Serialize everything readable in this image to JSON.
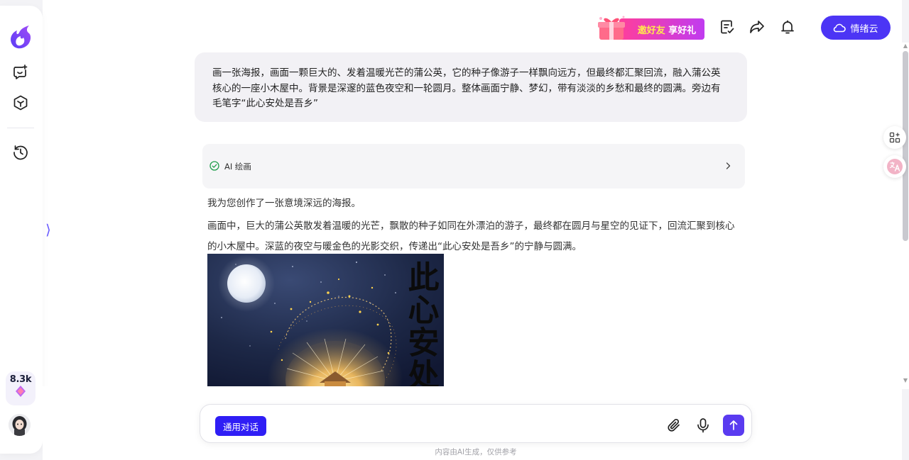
{
  "colors": {
    "accent": "#4c35f5",
    "send": "#5a3bf0",
    "invite_gradient_start": "#ff3f9b",
    "invite_gradient_end": "#c03bf0"
  },
  "sidebar": {
    "logo_icon": "flame-logo",
    "items": [
      {
        "icon": "chat-bubble-icon"
      },
      {
        "icon": "cube-icon"
      },
      {
        "icon": "history-icon"
      }
    ],
    "points": "8.3k",
    "points_icon": "diamond-icon",
    "collapse_glyph": "⟩"
  },
  "header": {
    "invite_part1": "邀好友",
    "invite_part2": "享好礼",
    "icons": [
      "edit-note-icon",
      "share-icon",
      "bell-icon"
    ],
    "cloud_label": "情绪云"
  },
  "chat": {
    "user_message": "画一张海报，画面一颗巨大的、发着温暖光芒的蒲公英，它的种子像游子一样飘向远方，但最终都汇聚回流，融入蒲公英核心的一座小木屋中。背景是深邃的蓝色夜空和一轮圆月。整体画面宁静、梦幻，带有淡淡的乡愁和最终的圆满。旁边有毛笔字“此心安处是吾乡”",
    "tool_label": "AI 绘画",
    "reply_line1": "我为您创作了一张意境深远的海报。",
    "reply_line2": "画面中，巨大的蒲公英散发着温暖的光芒，飘散的种子如同在外漂泊的游子，最终都在圆月与星空的见证下，回流汇聚到核心的小木屋中。深蓝的夜空与暖金色的光影交织，传递出“此心安处是吾乡”的宁静与圆满。",
    "poster_calligraphy": "此心安处"
  },
  "composer": {
    "mode_label": "通用对话",
    "placeholder": "",
    "icons": [
      "paperclip-icon",
      "microphone-icon",
      "send-arrow-icon"
    ]
  },
  "footer": {
    "disclaimer": "内容由AI生成，仅供参考"
  }
}
